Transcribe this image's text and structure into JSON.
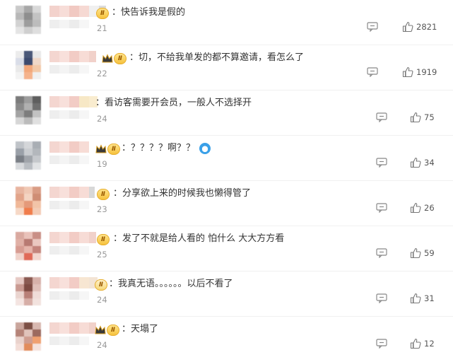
{
  "badge_label": "Ⅱ",
  "comments": [
    {
      "text": "：快告诉我是假的",
      "time": "21",
      "likes": "2821"
    },
    {
      "text": "：切，不给我单发的都不算邀请，看怎么了",
      "time": "22",
      "likes": "1919"
    },
    {
      "text": "：看访客需要开会员，一般人不选择开",
      "time": "24",
      "likes": "75"
    },
    {
      "text": "：？？？？啊？？",
      "time": "19",
      "likes": "34"
    },
    {
      "text": "：分享欲上来的时候我也懒得管了",
      "time": "23",
      "likes": "26"
    },
    {
      "text": "：发了不就是给人看的 怕什么 大大方方看",
      "time": "25",
      "likes": "59"
    },
    {
      "text": "：我真无语。。。。。。以后不看了",
      "time": "24",
      "likes": "31"
    },
    {
      "text": "：天塌了",
      "time": "24",
      "likes": "12"
    }
  ],
  "colors": {
    "text": "#333333",
    "muted": "#999999",
    "badge": "#f6c23e",
    "divider": "#f0f0f0"
  },
  "icons": {
    "reply": "comment-bubble-icon",
    "like": "thumbs-up-icon",
    "crown": "crown-icon",
    "emoji": "emoji-icon"
  }
}
